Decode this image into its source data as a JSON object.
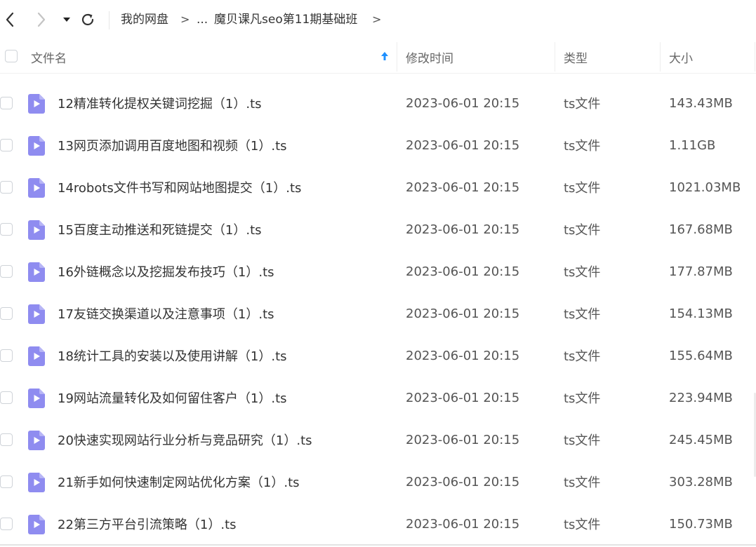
{
  "breadcrumb": {
    "root": "我的网盘",
    "ellipsis": "...",
    "current": "魔贝课凡seo第11期基础班",
    "arrow": ">"
  },
  "header": {
    "name": "文件名",
    "modified": "修改时间",
    "type": "类型",
    "size": "大小"
  },
  "colors": {
    "accent": "#1e90ff",
    "file_icon": "#8f8cf0"
  },
  "files": [
    {
      "name": "12精准转化提权关键词挖掘（1）.ts",
      "modified": "2023-06-01 20:15",
      "type": "ts文件",
      "size": "143.43MB"
    },
    {
      "name": "13网页添加调用百度地图和视频（1）.ts",
      "modified": "2023-06-01 20:15",
      "type": "ts文件",
      "size": "1.11GB"
    },
    {
      "name": "14robots文件书写和网站地图提交（1）.ts",
      "modified": "2023-06-01 20:15",
      "type": "ts文件",
      "size": "1021.03MB"
    },
    {
      "name": "15百度主动推送和死链提交（1）.ts",
      "modified": "2023-06-01 20:15",
      "type": "ts文件",
      "size": "167.68MB"
    },
    {
      "name": "16外链概念以及挖掘发布技巧（1）.ts",
      "modified": "2023-06-01 20:15",
      "type": "ts文件",
      "size": "177.87MB"
    },
    {
      "name": "17友链交换渠道以及注意事项（1）.ts",
      "modified": "2023-06-01 20:15",
      "type": "ts文件",
      "size": "154.13MB"
    },
    {
      "name": "18统计工具的安装以及使用讲解（1）.ts",
      "modified": "2023-06-01 20:15",
      "type": "ts文件",
      "size": "155.64MB"
    },
    {
      "name": "19网站流量转化及如何留住客户（1）.ts",
      "modified": "2023-06-01 20:15",
      "type": "ts文件",
      "size": "223.94MB"
    },
    {
      "name": "20快速实现网站行业分析与竞品研究（1）.ts",
      "modified": "2023-06-01 20:15",
      "type": "ts文件",
      "size": "245.45MB"
    },
    {
      "name": "21新手如何快速制定网站优化方案（1）.ts",
      "modified": "2023-06-01 20:15",
      "type": "ts文件",
      "size": "303.28MB"
    },
    {
      "name": "22第三方平台引流策略（1）.ts",
      "modified": "2023-06-01 20:15",
      "type": "ts文件",
      "size": "150.73MB"
    }
  ]
}
